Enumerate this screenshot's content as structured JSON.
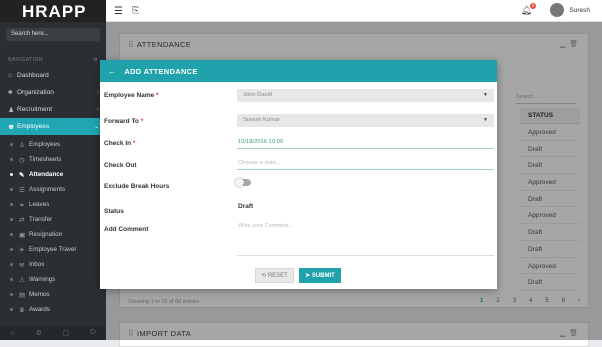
{
  "brand": "HRAPP",
  "sidebar": {
    "search_placeholder": "Search here...",
    "nav_caption": "NAVIGATION",
    "items": [
      {
        "label": "Dashboard",
        "icon": "home-icon"
      },
      {
        "label": "Organization",
        "icon": "org-icon"
      },
      {
        "label": "Recruitment",
        "icon": "recruit-icon"
      },
      {
        "label": "Employees",
        "icon": "users-icon"
      }
    ],
    "sub_items": [
      {
        "label": "Employees",
        "icon": "user-icon"
      },
      {
        "label": "Timesheets",
        "icon": "clock-icon"
      },
      {
        "label": "Attendance",
        "icon": "pencil-icon"
      },
      {
        "label": "Assignments",
        "icon": "list-icon"
      },
      {
        "label": "Leaves",
        "icon": "leaf-icon"
      },
      {
        "label": "Transfer",
        "icon": "transfer-icon"
      },
      {
        "label": "Resignation",
        "icon": "door-icon"
      },
      {
        "label": "Employee Travel",
        "icon": "plane-icon"
      },
      {
        "label": "Inbox",
        "icon": "inbox-icon"
      },
      {
        "label": "Warnings",
        "icon": "warning-icon"
      },
      {
        "label": "Memos",
        "icon": "memo-icon"
      },
      {
        "label": "Awards",
        "icon": "trophy-icon"
      }
    ]
  },
  "topbar": {
    "user_name": "Suresh",
    "notification_count": "5"
  },
  "panel": {
    "title": "ATTENDANCE",
    "search_placeholder": "Search...",
    "status_header": "STATUS",
    "statuses": [
      "Approved",
      "Draft",
      "Draft",
      "Approved",
      "Draft",
      "Approved",
      "Draft",
      "Draft",
      "Approved",
      "Draft"
    ],
    "entries_text": "Showing 1 to 10 of 60 entries",
    "pages": [
      "1",
      "2",
      "3",
      "4",
      "5",
      "6",
      "›"
    ]
  },
  "panel2": {
    "title": "IMPORT DATA"
  },
  "modal": {
    "title": "ADD ATTENDANCE",
    "employee_label": "Employee Name",
    "employee_value": "John David",
    "forward_label": "Forward To",
    "forward_value": "Suresh Kumar",
    "checkin_label": "Check In",
    "checkin_value": "10/18/2016 10:09",
    "checkout_label": "Check Out",
    "checkout_placeholder": "Choose a date...",
    "exclude_label": "Exclude Break Hours",
    "status_label": "Status",
    "status_value": "Draft",
    "comment_label": "Add Comment",
    "comment_placeholder": "Write your Comment...",
    "reset_label": "⟲ RESET",
    "submit_label": "➤ SUBMIT"
  }
}
